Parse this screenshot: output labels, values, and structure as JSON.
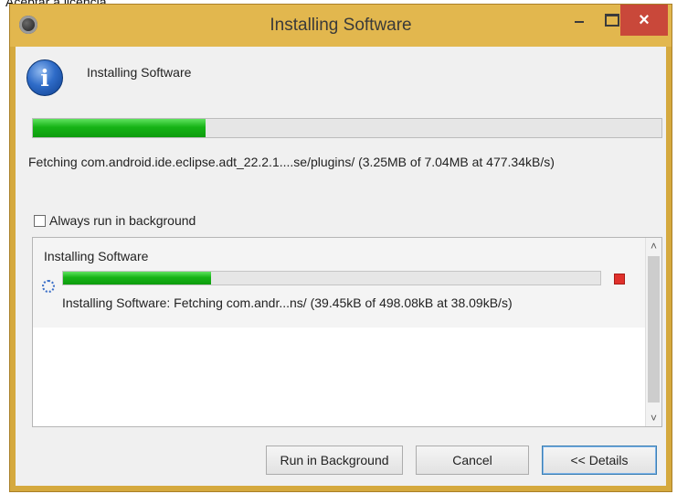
{
  "page": {
    "caption": "Aceptar a licencia."
  },
  "window": {
    "title": "Installing Software",
    "min_label": "–",
    "max_label": "□",
    "close_label": "×"
  },
  "header": {
    "icon": "info-icon",
    "label": "Installing Software"
  },
  "main_progress": {
    "fraction": 0.275,
    "status": "Fetching com.android.ide.eclipse.adt_22.2.1....se/plugins/ (3.25MB of 7.04MB at 477.34kB/s)"
  },
  "options": {
    "always_background_label": "Always run in background",
    "always_background_checked": false
  },
  "details": {
    "job": {
      "title": "Installing Software",
      "icon": "spinner-icon",
      "fraction": 0.275,
      "status": "Installing Software: Fetching com.andr...ns/ (39.45kB of 498.08kB at 38.09kB/s)",
      "stop_icon": "stop-icon"
    },
    "scroll_up_glyph": "˄",
    "scroll_down_glyph": "˅"
  },
  "buttons": {
    "run_in_background": "Run in Background",
    "cancel": "Cancel",
    "details": "<< Details"
  },
  "colors": {
    "title_bar": "#e2b74e",
    "close_button": "#c9483a",
    "progress_fill": "#16b316"
  }
}
